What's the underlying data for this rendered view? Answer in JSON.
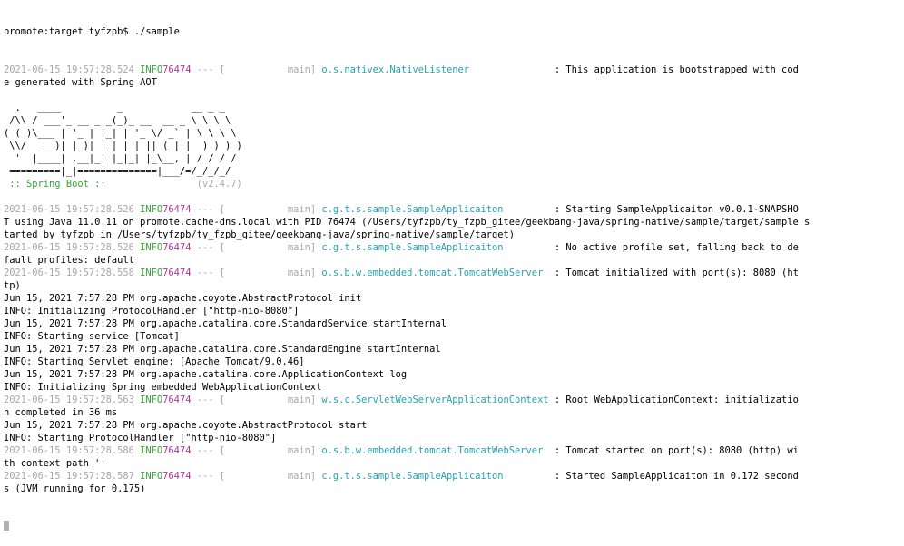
{
  "colors": {
    "timestamp": "#a8a8a8",
    "level": "#36a336",
    "pid": "#b2359a",
    "logger": "#27a3b3",
    "text": "#000000",
    "background": "#ffffff"
  },
  "prompt": {
    "text": "promote:target tyfzpb$ ./sample"
  },
  "lines": [
    {
      "ts": "2021-06-15 19:57:28.524",
      "lvl": " INFO",
      "pid": "76474",
      "sep": " --- [",
      "thr": "           main]",
      "lg": " o.s.nativex.NativeListener              ",
      "msg": " : This application is bootstrapped with cod"
    },
    {
      "text": "e generated with Spring AOT"
    },
    {
      "text": ""
    },
    {
      "text": "  .   ____          _            __ _ _"
    },
    {
      "text": " /\\\\ / ___'_ __ _ _(_)_ __  __ _ \\ \\ \\ \\"
    },
    {
      "text": "( ( )\\___ | '_ | '_| | '_ \\/ _` | \\ \\ \\ \\"
    },
    {
      "text": " \\\\/  ___)| |_)| | | | | || (_| |  ) ) ) )"
    },
    {
      "text": "  '  |____| .__|_| |_|_| |_\\__, | / / / /"
    },
    {
      "text": " =========|_|==============|___/=/_/_/_/"
    },
    {
      "boot_label": " :: Spring Boot ::",
      "boot_ver": "                (v2.4.7)"
    },
    {
      "text": ""
    },
    {
      "ts": "2021-06-15 19:57:28.526",
      "lvl": " INFO",
      "pid": "76474",
      "sep": " --- [",
      "thr": "           main]",
      "lg": " c.g.t.s.sample.SampleApplicaiton        ",
      "msg": " : Starting SampleApplicaiton v0.0.1-SNAPSHO"
    },
    {
      "text": "T using Java 11.0.11 on promote.cache-dns.local with PID 76474 (/Users/tyfzpb/ty_fzpb_gitee/geekbang-java/spring-native/sample/target/sample s"
    },
    {
      "text": "tarted by tyfzpb in /Users/tyfzpb/ty_fzpb_gitee/geekbang-java/spring-native/sample/target)"
    },
    {
      "ts": "2021-06-15 19:57:28.526",
      "lvl": " INFO",
      "pid": "76474",
      "sep": " --- [",
      "thr": "           main]",
      "lg": " c.g.t.s.sample.SampleApplicaiton        ",
      "msg": " : No active profile set, falling back to de"
    },
    {
      "text": "fault profiles: default"
    },
    {
      "ts": "2021-06-15 19:57:28.558",
      "lvl": " INFO",
      "pid": "76474",
      "sep": " --- [",
      "thr": "           main]",
      "lg": " o.s.b.w.embedded.tomcat.TomcatWebServer ",
      "msg": " : Tomcat initialized with port(s): 8080 (ht"
    },
    {
      "text": "tp)"
    },
    {
      "text": "Jun 15, 2021 7:57:28 PM org.apache.coyote.AbstractProtocol init"
    },
    {
      "text": "INFO: Initializing ProtocolHandler [\"http-nio-8080\"]"
    },
    {
      "text": "Jun 15, 2021 7:57:28 PM org.apache.catalina.core.StandardService startInternal"
    },
    {
      "text": "INFO: Starting service [Tomcat]"
    },
    {
      "text": "Jun 15, 2021 7:57:28 PM org.apache.catalina.core.StandardEngine startInternal"
    },
    {
      "text": "INFO: Starting Servlet engine: [Apache Tomcat/9.0.46]"
    },
    {
      "text": "Jun 15, 2021 7:57:28 PM org.apache.catalina.core.ApplicationContext log"
    },
    {
      "text": "INFO: Initializing Spring embedded WebApplicationContext"
    },
    {
      "ts": "2021-06-15 19:57:28.563",
      "lvl": " INFO",
      "pid": "76474",
      "sep": " --- [",
      "thr": "           main]",
      "lg": " w.s.c.ServletWebServerApplicationContext",
      "msg": " : Root WebApplicationContext: initializatio"
    },
    {
      "text": "n completed in 36 ms"
    },
    {
      "text": "Jun 15, 2021 7:57:28 PM org.apache.coyote.AbstractProtocol start"
    },
    {
      "text": "INFO: Starting ProtocolHandler [\"http-nio-8080\"]"
    },
    {
      "ts": "2021-06-15 19:57:28.586",
      "lvl": " INFO",
      "pid": "76474",
      "sep": " --- [",
      "thr": "           main]",
      "lg": " o.s.b.w.embedded.tomcat.TomcatWebServer ",
      "msg": " : Tomcat started on port(s): 8080 (http) wi"
    },
    {
      "text": "th context path ''"
    },
    {
      "ts": "2021-06-15 19:57:28.587",
      "lvl": " INFO",
      "pid": "76474",
      "sep": " --- [",
      "thr": "           main]",
      "lg": " c.g.t.s.sample.SampleApplicaiton        ",
      "msg": " : Started SampleApplicaiton in 0.172 second"
    },
    {
      "text": "s (JVM running for 0.175)"
    }
  ]
}
